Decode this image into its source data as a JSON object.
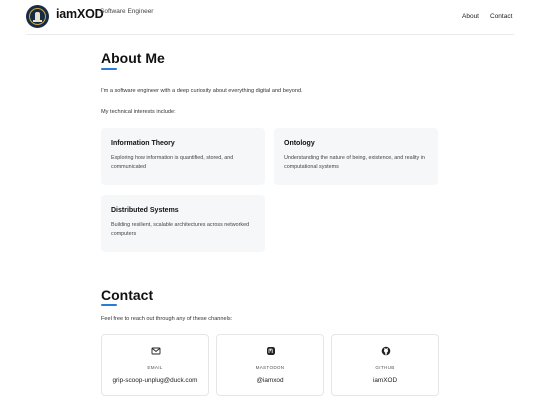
{
  "header": {
    "brand": "iamXOD",
    "subtitle": "Software Engineer",
    "nav": [
      "About",
      "Contact"
    ],
    "logo_icon": "lighthouse-seal-icon",
    "logo_text": "XOD"
  },
  "about": {
    "title": "About Me",
    "intro": "I'm a software engineer with a deep curiosity about everything digital and beyond.",
    "interests_lead": "My technical interests include:",
    "interests": [
      {
        "title": "Information Theory",
        "desc": "Exploring how information is quantified, stored, and communicated"
      },
      {
        "title": "Ontology",
        "desc": "Understanding the nature of being, existence, and reality in computational systems"
      },
      {
        "title": "Distributed Systems",
        "desc": "Building resilient, scalable architectures across networked computers"
      }
    ]
  },
  "contact": {
    "title": "Contact",
    "lead": "Feel free to reach out through any of these channels:",
    "channels": [
      {
        "label": "EMAIL",
        "value": "grip-scoop-unplug@duck.com",
        "icon": "envelope-icon"
      },
      {
        "label": "MASTODON",
        "value": "@iamxod",
        "icon": "mastodon-icon"
      },
      {
        "label": "GITHUB",
        "value": "iamXOD",
        "icon": "github-icon"
      }
    ]
  },
  "colors": {
    "accent": "#2a7bd4",
    "card_bg": "#f6f7f9",
    "logo_bg": "#172b45"
  }
}
